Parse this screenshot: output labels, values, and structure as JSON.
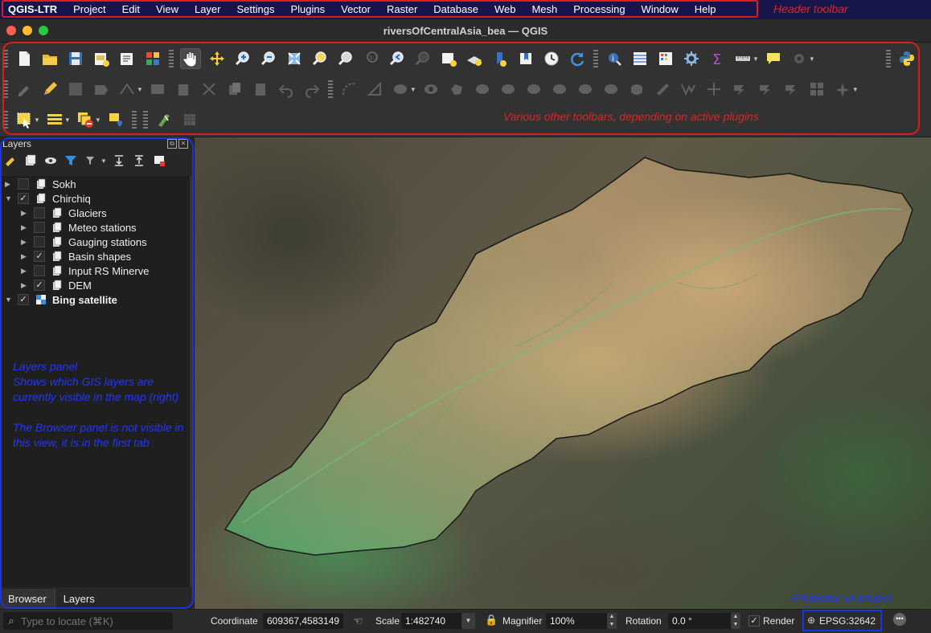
{
  "menu": {
    "app": "QGIS-LTR",
    "items": [
      "Project",
      "Edit",
      "View",
      "Layer",
      "Settings",
      "Plugins",
      "Vector",
      "Raster",
      "Database",
      "Web",
      "Mesh",
      "Processing",
      "Window",
      "Help"
    ]
  },
  "annotations": {
    "header_toolbar": "Header toolbar",
    "other_toolbars": "Various other toolbars, depending on active plugins",
    "layers_panel_line1": "Layers panel",
    "layers_panel_line2": "Shows which GIS layers are currently visible in the map (right)",
    "browser_note": "The Browser panel is not visible in this view, it is in the first tab",
    "projection": "Projection of project"
  },
  "window": {
    "title": "riversOfCentralAsia_bea — QGIS"
  },
  "toolbars": {
    "row1": [
      "new-project-icon",
      "open-project-icon",
      "save-project-icon",
      "new-print-layout-icon",
      "layout-manager-icon",
      "style-manager-icon",
      "pan-icon",
      "pan-to-selection-icon",
      "zoom-in-icon",
      "zoom-out-icon",
      "zoom-full-icon",
      "zoom-to-selection-icon",
      "zoom-to-layer-icon",
      "zoom-native-icon",
      "zoom-last-icon",
      "zoom-next-icon",
      "new-map-view-icon",
      "new-3d-map-view-icon",
      "temporal-controller-icon",
      "show-bookmarks-icon",
      "refresh-icon",
      "identify-icon",
      "attribute-table-icon",
      "field-calculator-icon",
      "toolbox-icon",
      "statistics-icon",
      "measure-icon",
      "map-tips-icon",
      "plugin-gear-icon",
      "python-console-icon"
    ],
    "row2": [
      "current-edits-icon",
      "toggle-editing-icon",
      "save-edits-icon",
      "add-feature-icon",
      "vertex-tool-icon",
      "digitize-icon",
      "delete-selected-icon",
      "cut-icon",
      "copy-icon",
      "paste-icon",
      "undo-icon",
      "redo-icon",
      "digitize-curve-icon",
      "shape-digitize-icon",
      "add-ring-icon",
      "fill-ring-icon",
      "delete-ring-icon",
      "delete-part-icon",
      "reshape-icon",
      "offset-curve-icon",
      "split-features-icon",
      "split-parts-icon",
      "merge-features-icon",
      "merge-attributes-icon",
      "rotate-point-icon",
      "simplify-icon",
      "add-part-icon",
      "reverse-line-icon",
      "trim-extend-icon",
      "move-label-icon",
      "rotate-label-icon",
      "change-label-icon",
      "label-table-icon",
      "pin-label-icon"
    ],
    "row3": [
      "select-features-icon",
      "select-by-value-icon",
      "deselect-icon",
      "select-location-icon",
      "digitize-tools-icon",
      "layer-settings-icon"
    ]
  },
  "layers_panel": {
    "title": "Layers",
    "tabs": [
      "Browser",
      "Layers"
    ],
    "layers": [
      {
        "name": "Sokh",
        "checked": false,
        "level": 0,
        "expanded": false,
        "icon": "group-icon"
      },
      {
        "name": "Chirchiq",
        "checked": true,
        "level": 0,
        "expanded": true,
        "icon": "group-icon"
      },
      {
        "name": "Glaciers",
        "checked": false,
        "level": 1,
        "expanded": false,
        "icon": "group-icon"
      },
      {
        "name": "Meteo stations",
        "checked": false,
        "level": 1,
        "expanded": false,
        "icon": "group-icon"
      },
      {
        "name": "Gauging stations",
        "checked": false,
        "level": 1,
        "expanded": false,
        "icon": "group-icon"
      },
      {
        "name": "Basin shapes",
        "checked": true,
        "level": 1,
        "expanded": false,
        "icon": "group-icon"
      },
      {
        "name": "Input RS Minerve",
        "checked": false,
        "level": 1,
        "expanded": false,
        "icon": "group-icon"
      },
      {
        "name": "DEM",
        "checked": true,
        "level": 1,
        "expanded": false,
        "icon": "group-icon"
      },
      {
        "name": "Bing satellite",
        "checked": true,
        "level": 0,
        "expanded": true,
        "icon": "xyz-tile-icon",
        "bold": true
      }
    ]
  },
  "status": {
    "locate_placeholder": "Type to locate (⌘K)",
    "coordinate_label": "Coordinate",
    "coordinate_value": "609367,4583149",
    "scale_label": "Scale",
    "scale_value": "1:482740",
    "magnifier_label": "Magnifier",
    "magnifier_value": "100%",
    "rotation_label": "Rotation",
    "rotation_value": "0.0 °",
    "render_label": "Render",
    "render_checked": true,
    "crs": "EPSG:32642"
  },
  "colors": {
    "menu_bg": "#16164a",
    "annotation_red": "#e01b1b",
    "annotation_blue": "#1b34e6"
  }
}
